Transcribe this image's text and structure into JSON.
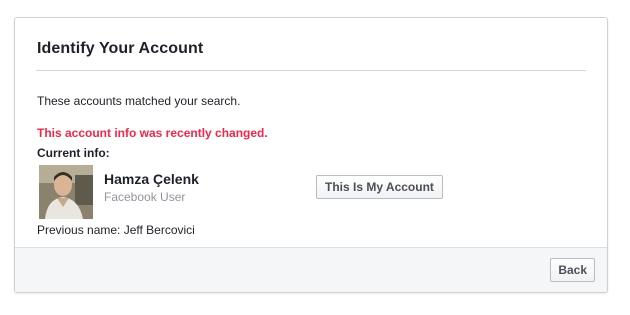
{
  "dialog": {
    "title": "Identify Your Account"
  },
  "content": {
    "matched_text": "These accounts matched your search.",
    "warning_text": "This account info was recently changed.",
    "current_label": "Current info:",
    "account": {
      "name": "Hamza Çelenk",
      "subtitle": "Facebook User",
      "avatar_icon": "profile-photo",
      "button_label": "This Is My Account"
    },
    "previous_name": "Previous name: Jeff Bercovici"
  },
  "footer": {
    "back_label": "Back"
  },
  "colors": {
    "warning": "#f02849",
    "title": "#1d2129",
    "muted": "#90949c",
    "footer_bg": "#f5f6f7"
  }
}
